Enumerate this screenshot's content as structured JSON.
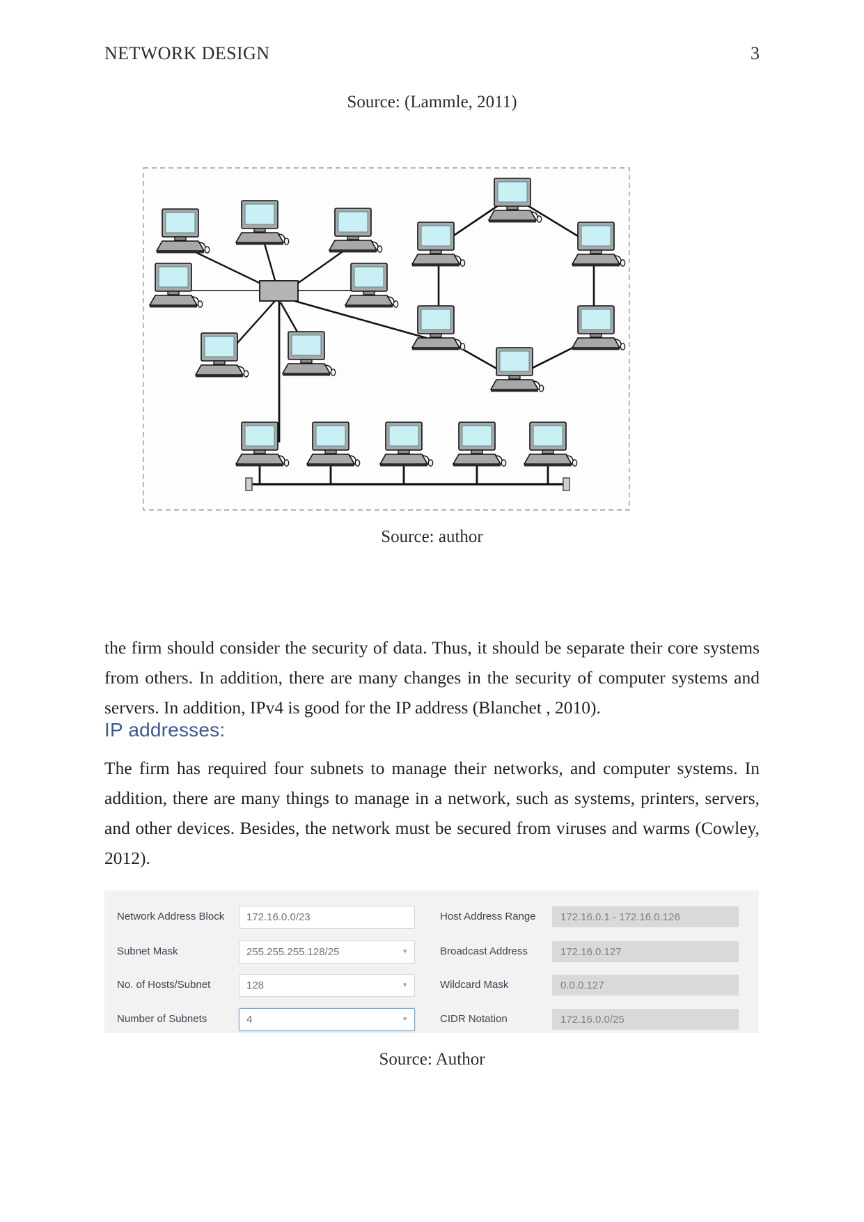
{
  "header": {
    "title": "NETWORK DESIGN",
    "page_number": "3"
  },
  "captions": {
    "lammle": "Source: (Lammle, 2011)",
    "author_diagram": "Source: author",
    "author_calculator": "Source: Author"
  },
  "body": {
    "paragraph_1": "the firm should consider the security of data. Thus, it should be separate their core systems from others. In addition, there are many changes in the security of computer systems and servers. In addition, IPv4 is good for the IP address  (Blanchet , 2010).",
    "heading_ip": "IP addresses:",
    "paragraph_2": "The firm has required four subnets to manage their networks, and computer systems. In addition, there are many things to manage in a network, such as systems, printers, servers, and other devices. Besides, the network must be secured from viruses and warms  (Cowley, 2012)."
  },
  "diagram": {
    "alt": "network-topology-diagram",
    "topologies": [
      "star",
      "ring",
      "bus"
    ],
    "node_count": 18,
    "colors": {
      "screen": "#c9f0f5",
      "case": "#a8a8a8",
      "outline": "#1a1a1a",
      "border": "#9a9a9a"
    }
  },
  "calculator": {
    "fields": [
      {
        "label": "Network Address Block",
        "value": "172.16.0.0/23",
        "kind": "text",
        "focused": false
      },
      {
        "label": "Subnet Mask",
        "value": "255.255.255.128/25",
        "kind": "select",
        "focused": false
      },
      {
        "label": "No. of Hosts/Subnet",
        "value": "128",
        "kind": "select",
        "focused": false
      },
      {
        "label": "Number of Subnets",
        "value": "4",
        "kind": "select",
        "focused": true
      }
    ],
    "results": [
      {
        "label": "Host Address Range",
        "value": "172.16.0.1  -  172.16.0.126"
      },
      {
        "label": "Broadcast Address",
        "value": "172.16.0.127"
      },
      {
        "label": "Wildcard Mask",
        "value": "0.0.0.127"
      },
      {
        "label": "CIDR Notation",
        "value": "172.16.0.0/25"
      }
    ],
    "dropdown_glyph": "▼"
  },
  "colors": {
    "heading_blue": "#3b5a96",
    "panel_bg": "#f2f2f2",
    "readonly_bg": "#d9d9d9",
    "focus_border": "#7aa7d6"
  }
}
